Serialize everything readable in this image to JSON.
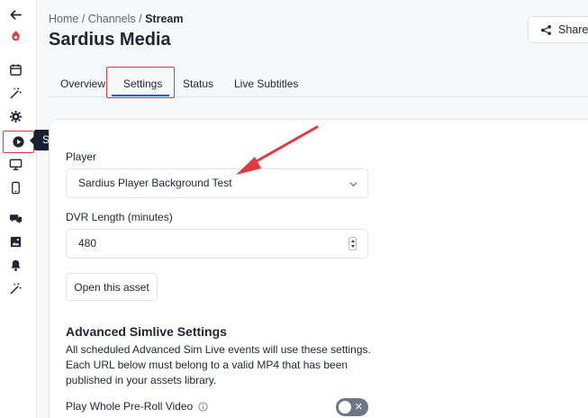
{
  "sidebar": {
    "items": [
      {
        "name": "back-arrow-icon"
      },
      {
        "name": "logo-icon"
      },
      {
        "name": "calendar-icon"
      },
      {
        "name": "magic-wand-icon"
      },
      {
        "name": "gear-icon"
      },
      {
        "name": "play-icon",
        "active": true
      },
      {
        "name": "monitor-icon"
      },
      {
        "name": "tablet-icon"
      },
      {
        "name": "chat-icon"
      },
      {
        "name": "image-gallery-icon"
      },
      {
        "name": "bell-icon"
      },
      {
        "name": "magic-wand-icon"
      }
    ],
    "tooltip": "Stream"
  },
  "breadcrumb": {
    "home": "Home",
    "sep": "/",
    "channels": "Channels",
    "current": "Stream"
  },
  "page_title": "Sardius Media",
  "share_label": "Share",
  "tabs": [
    {
      "label": "Overview"
    },
    {
      "label": "Settings",
      "active": true
    },
    {
      "label": "Status"
    },
    {
      "label": "Live Subtitles"
    }
  ],
  "form": {
    "player_label": "Player",
    "player_value": "Sardius Player Background Test",
    "dvr_label": "DVR Length (minutes)",
    "dvr_value": "480",
    "open_asset_label": "Open this asset"
  },
  "advanced": {
    "title": "Advanced Simlive Settings",
    "description": "All scheduled Advanced Sim Live events will use these settings. Each URL below must belong to a valid MP4 that has been published in your assets library.",
    "preroll_label": "Play Whole Pre-Roll Video",
    "preroll_enabled": false
  },
  "colors": {
    "accent": "#2a5bd7",
    "highlight": "#e4373f",
    "tooltip_bg": "#172033"
  }
}
